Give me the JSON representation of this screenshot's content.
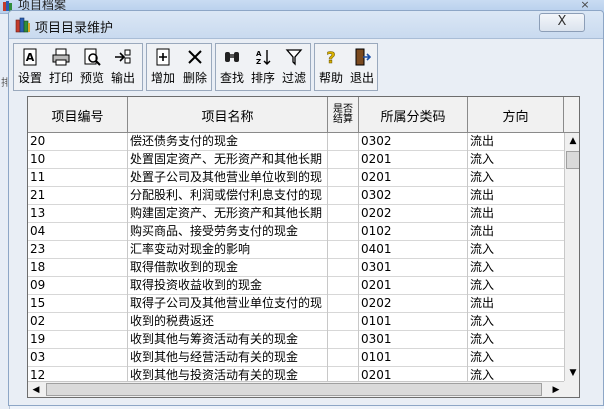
{
  "background_window": {
    "title": "项目档案",
    "close_label": "×"
  },
  "dialog": {
    "title": "项目目录维护",
    "close_label": "X"
  },
  "toolbar": {
    "buttons": [
      {
        "label": "设置",
        "icon": "settings-icon"
      },
      {
        "label": "打印",
        "icon": "printer-icon"
      },
      {
        "label": "预览",
        "icon": "preview-icon"
      },
      {
        "label": "输出",
        "icon": "export-icon"
      },
      {
        "label": "增加",
        "icon": "add-icon"
      },
      {
        "label": "删除",
        "icon": "delete-icon"
      },
      {
        "label": "查找",
        "icon": "find-icon"
      },
      {
        "label": "排序",
        "icon": "sort-icon"
      },
      {
        "label": "过滤",
        "icon": "filter-icon"
      },
      {
        "label": "帮助",
        "icon": "help-icon"
      },
      {
        "label": "退出",
        "icon": "exit-icon"
      }
    ]
  },
  "grid": {
    "columns": [
      "项目编号",
      "项目名称",
      "是否结算",
      "所属分类码",
      "方向"
    ],
    "rows": [
      [
        "20",
        "偿还债务支付的现金",
        "",
        "0302",
        "流出"
      ],
      [
        "10",
        "处置固定资产、无形资产和其他长期",
        "",
        "0201",
        "流入"
      ],
      [
        "11",
        "处置子公司及其他营业单位收到的现",
        "",
        "0201",
        "流入"
      ],
      [
        "21",
        "分配股利、利润或偿付利息支付的现",
        "",
        "0302",
        "流出"
      ],
      [
        "13",
        "购建固定资产、无形资产和其他长期",
        "",
        "0202",
        "流出"
      ],
      [
        "04",
        "购买商品、接受劳务支付的现金",
        "",
        "0102",
        "流出"
      ],
      [
        "23",
        "汇率变动对现金的影响",
        "",
        "0401",
        "流入"
      ],
      [
        "18",
        "取得借款收到的现金",
        "",
        "0301",
        "流入"
      ],
      [
        "09",
        "取得投资收益收到的现金",
        "",
        "0201",
        "流入"
      ],
      [
        "15",
        "取得子公司及其他营业单位支付的现",
        "",
        "0202",
        "流出"
      ],
      [
        "02",
        "收到的税费返还",
        "",
        "0101",
        "流入"
      ],
      [
        "19",
        "收到其他与筹资活动有关的现金",
        "",
        "0301",
        "流入"
      ],
      [
        "03",
        "收到其他与经营活动有关的现金",
        "",
        "0101",
        "流入"
      ],
      [
        "12",
        "收到其他与投资活动有关的现金",
        "",
        "0201",
        "流入"
      ]
    ]
  }
}
